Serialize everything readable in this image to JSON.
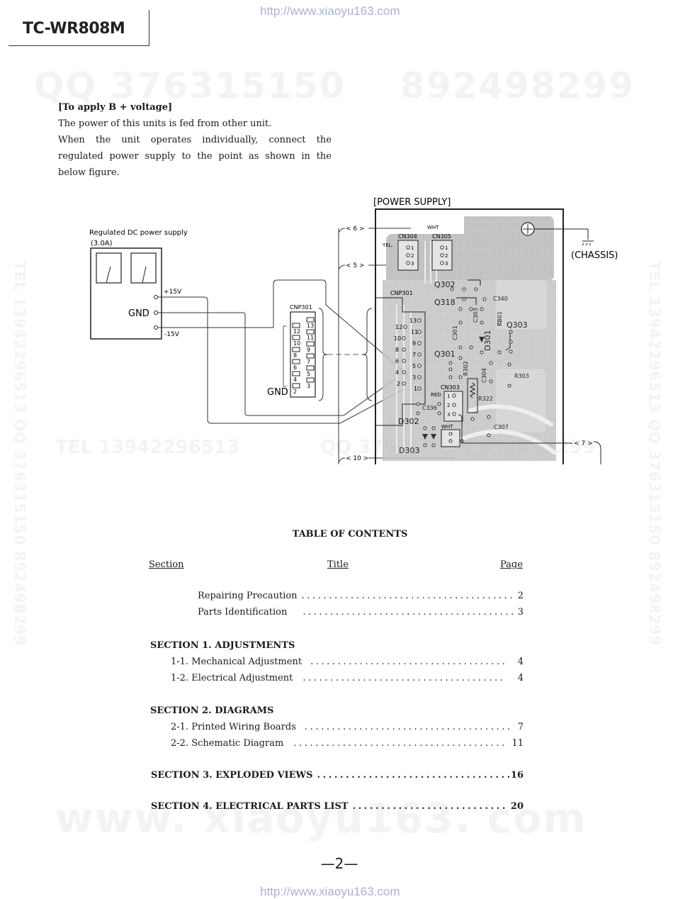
{
  "header": {
    "model": "TC-WR808M",
    "url_top": "http://www.xiaoyu163.com"
  },
  "watermarks": {
    "top_left": "QQ 376315150",
    "top_right": "892498299",
    "middle_left": "TEL 13942296513",
    "middle_right": "QQ 376315150 892498299",
    "bottom": "www. xiaoyu163. com",
    "vertical": "TEL 13942296513  QQ 376315150  892498299"
  },
  "intro": {
    "heading": "[To apply B + voltage]",
    "line1": "The power of this units is fed from other unit.",
    "para": "When the unit operates individually, connect the regulated power supply to the point as shown in the below figure."
  },
  "diagram": {
    "psu_label": "Regulated DC power supply",
    "psu_current": "(3.0A)",
    "plus_v": "+15V",
    "minus_v": "-15V",
    "gnd": "GND",
    "connector_label": "CNP301",
    "connector_pins_left": [
      "12",
      "10",
      "8",
      "6",
      "4",
      "2"
    ],
    "connector_pins_right": [
      "13",
      "11",
      "9",
      "7",
      "5",
      "3"
    ],
    "board_title": "[POWER SUPPLY]",
    "chassis": "(CHASSIS)",
    "wht": "WHT",
    "yel": "YEL.",
    "red": "RED",
    "cn304": "CN304",
    "cn305": "CN305",
    "cn303": "CN303",
    "cnp301_board": "CNP301",
    "components": [
      "Q302",
      "Q318",
      "C340",
      "Q303",
      "C301",
      "C303",
      "D301",
      "R301",
      "Q301",
      "R302",
      "C304",
      "R303",
      "R322",
      "C336",
      "D302",
      "C307",
      "D303"
    ],
    "arrows": [
      "6",
      "5",
      "7",
      "10"
    ]
  },
  "toc": {
    "title": "TABLE OF CONTENTS",
    "col_section": "Section",
    "col_title": "Title",
    "col_page": "Page",
    "front": [
      {
        "title": "Repairing Precaution",
        "page": "2"
      },
      {
        "title": "Parts Identification",
        "page": "3"
      }
    ],
    "sections": [
      {
        "heading": "SECTION 1. ADJUSTMENTS",
        "items": [
          {
            "title": "1-1. Mechanical Adjustment",
            "page": "4"
          },
          {
            "title": "1-2. Electrical Adjustment",
            "page": "4"
          }
        ]
      },
      {
        "heading": "SECTION 2. DIAGRAMS",
        "items": [
          {
            "title": "2-1. Printed Wiring Boards",
            "page": "7"
          },
          {
            "title": "2-2. Schematic Diagram",
            "page": "11"
          }
        ]
      }
    ],
    "single_sections": [
      {
        "title": "SECTION 3. EXPLODED VIEWS",
        "page": "16"
      },
      {
        "title": "SECTION 4. ELECTRICAL PARTS LIST",
        "page": "20"
      }
    ]
  },
  "footer": {
    "page": "—2—",
    "url_bottom": "http://www.xiaoyu163.com"
  }
}
